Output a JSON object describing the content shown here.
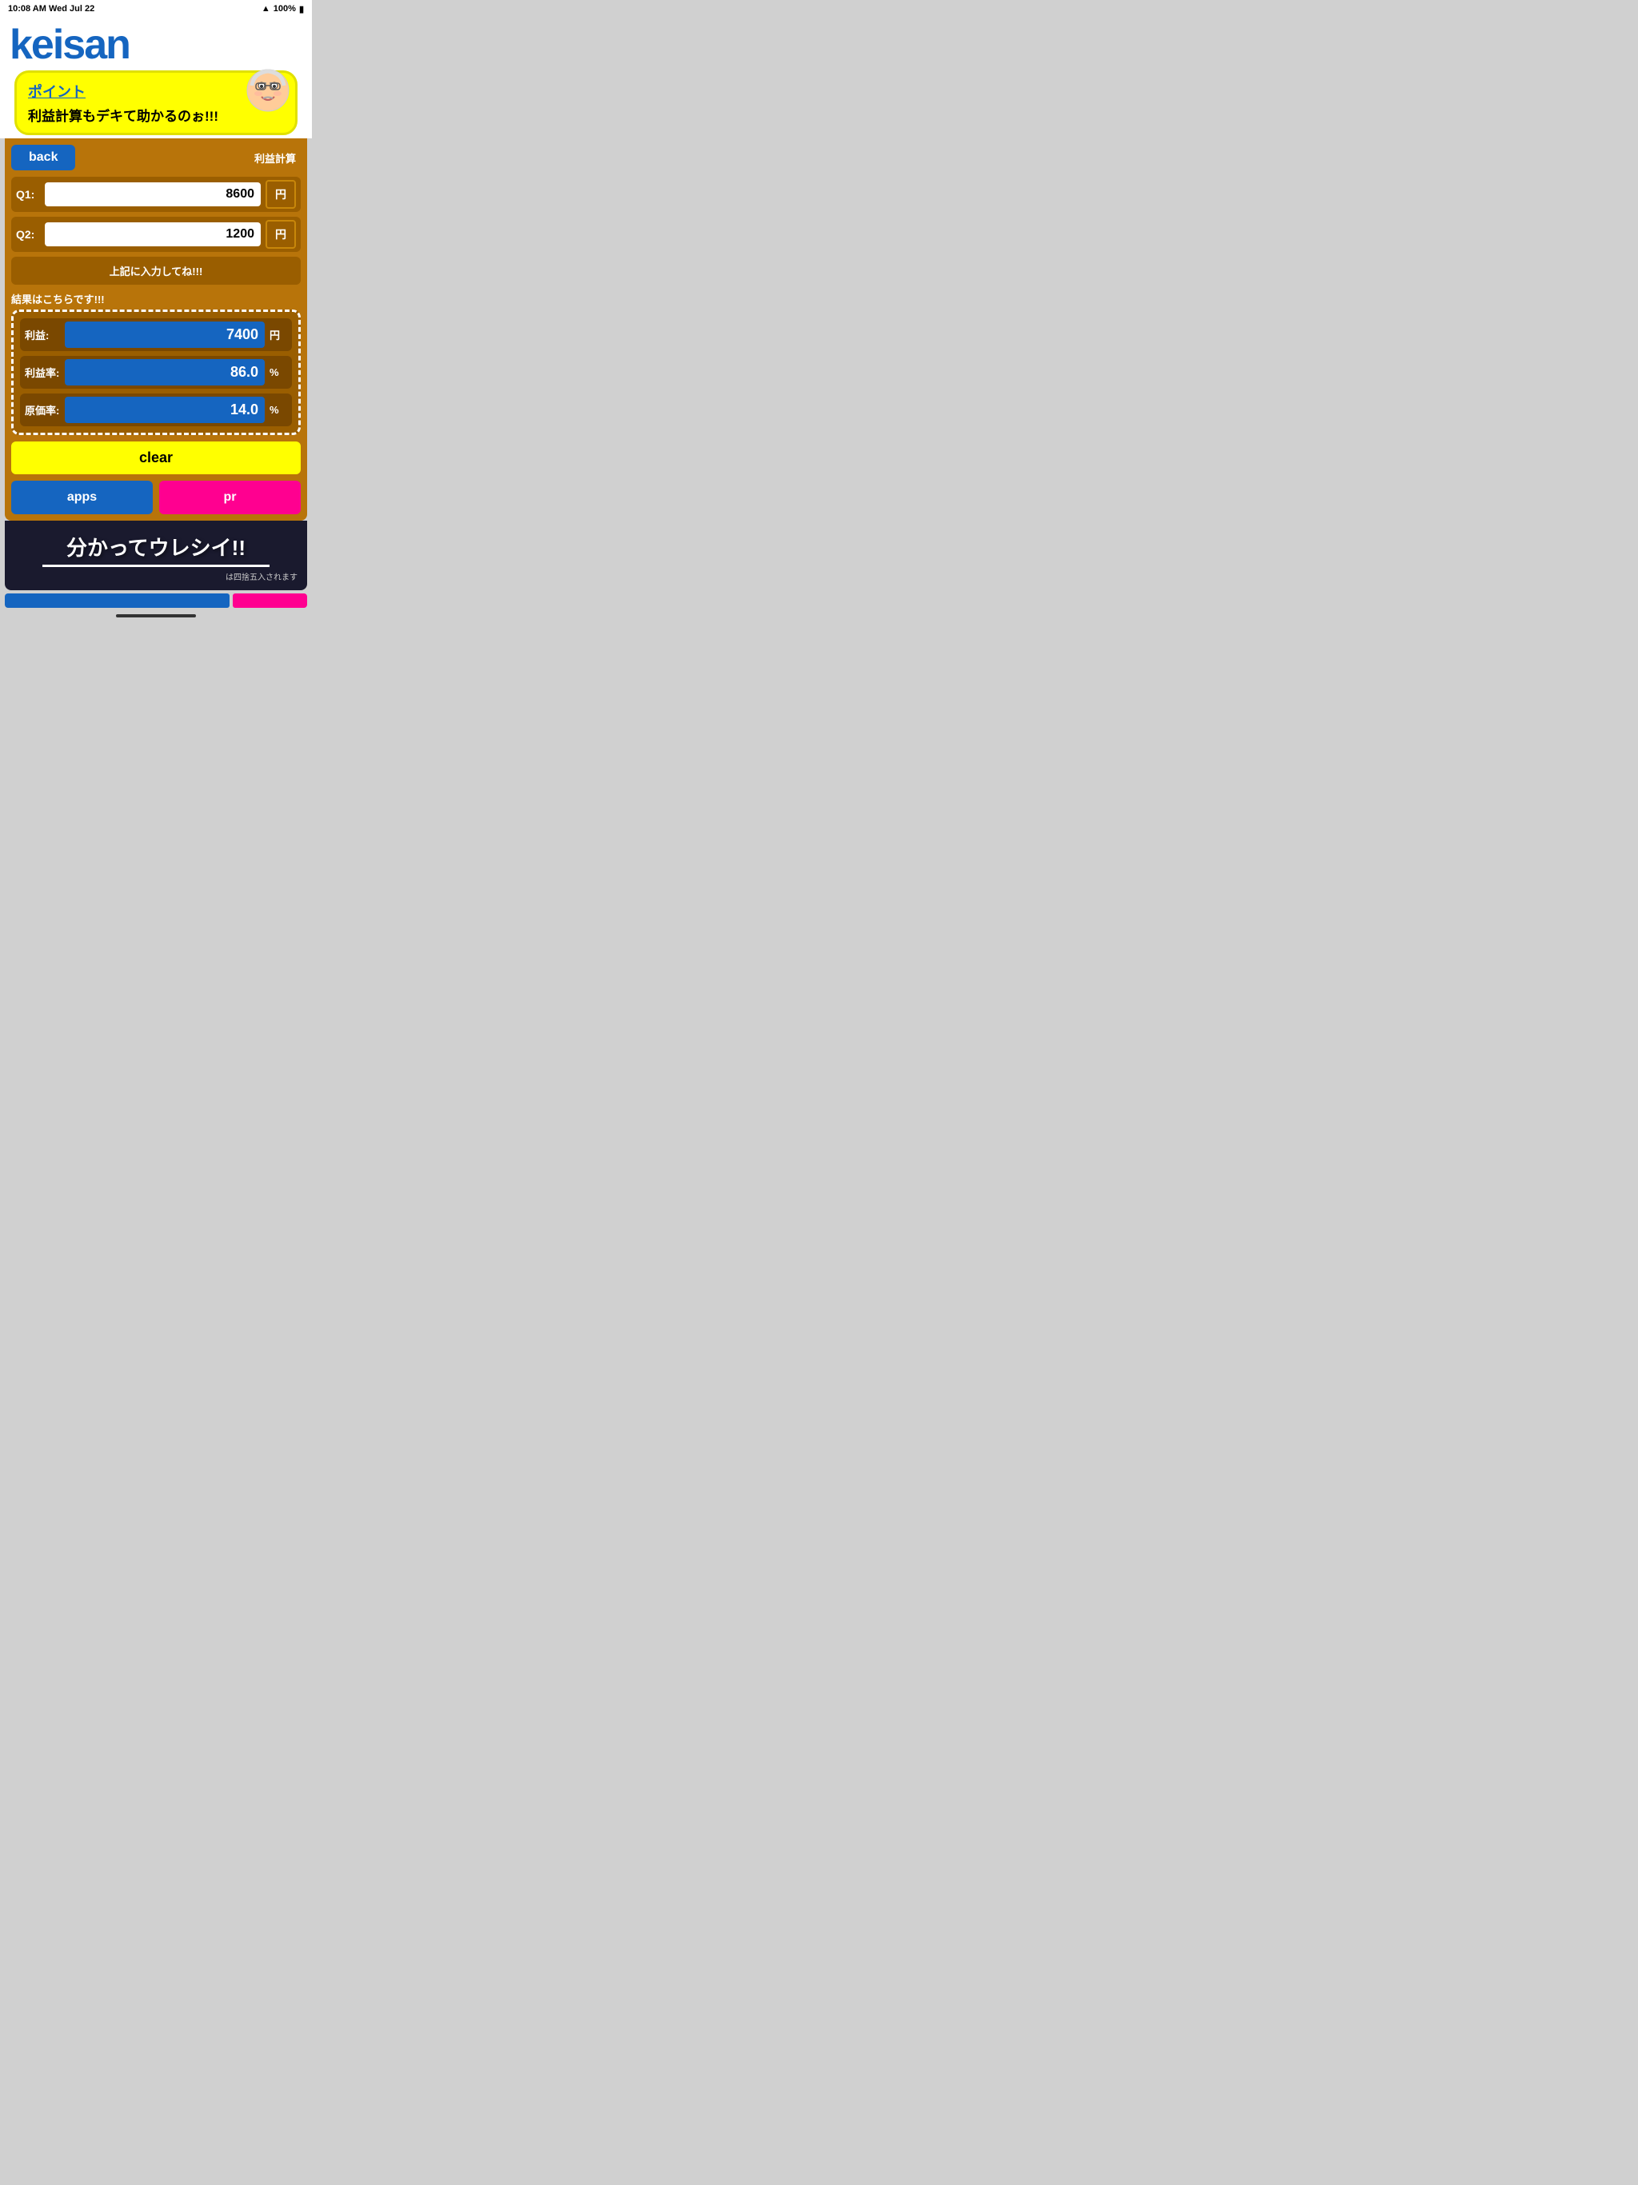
{
  "statusBar": {
    "time": "10:08 AM",
    "date": "Wed Jul 22",
    "signal": "100%",
    "battery": "100%"
  },
  "logo": {
    "text": "keisan"
  },
  "tooltip": {
    "title": "ポイント",
    "body": "利益計算もデキて助かるのぉ!!!"
  },
  "header": {
    "backLabel": "back",
    "titleLabel": "利益計算"
  },
  "inputs": {
    "q1": {
      "label": "Q1:",
      "value": "8600",
      "unit": "円"
    },
    "q2": {
      "label": "Q2:",
      "value": "1200",
      "unit": "円"
    }
  },
  "promptBar": {
    "text": "上記に入力してね!!!"
  },
  "resultsSection": {
    "label": "結果はこちらです!!!",
    "rows": [
      {
        "label": "利益:",
        "value": "7400",
        "unit": "円"
      },
      {
        "label": "利益率:",
        "value": "86.0",
        "unit": "%"
      },
      {
        "label": "原価率:",
        "value": "14.0",
        "unit": "%"
      }
    ]
  },
  "clearBtn": {
    "label": "clear"
  },
  "appsBtn": {
    "label": "apps"
  },
  "prBtn": {
    "label": "pr"
  },
  "bottomBanner": {
    "mainText": "分かってウレシイ!!",
    "footnote": "は四捨五入されます"
  }
}
